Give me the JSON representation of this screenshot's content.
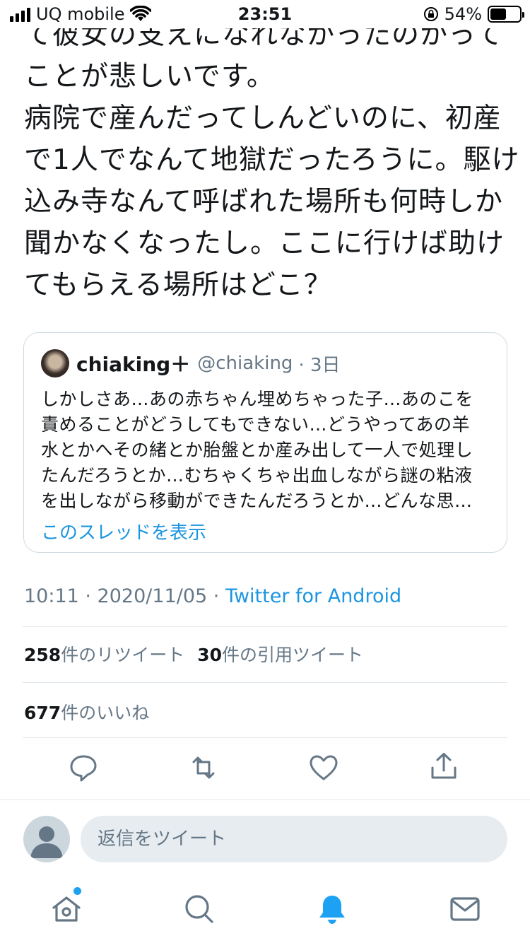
{
  "status_bar": {
    "carrier": "UQ mobile",
    "time": "23:51",
    "battery_percent": "54%",
    "battery_level": 0.54
  },
  "tweet": {
    "lines": [
      "て彼女の支えになれなかったのかって",
      "ことが悲しいです。",
      "病院で産んだってしんどいのに、初産",
      "で1人でなんて地獄だったろうに。駆け",
      "込み寺なんて呼ばれた場所も何時しか",
      "聞かなくなったし。ここに行けば助け",
      "てもらえる場所はどこ？"
    ]
  },
  "quote": {
    "name": "chiaking＋",
    "handle": "@chiaking",
    "time": "· 3日",
    "lines": [
      "しかしさあ…あの赤ちゃん埋めちゃった子…あのこを",
      "責めることがどうしてもできない…どうやってあの羊",
      "水とかへその緒とか胎盤とか産み出して一人で処理し",
      "たんだろうとか…むちゃくちゃ出血しながら謎の粘液",
      "を出しながら移動ができたんだろうとか…どんな思…"
    ],
    "show_thread": "このスレッドを表示"
  },
  "meta": {
    "timestamp": "10:11 · 2020/11/05 · ",
    "source": "Twitter for Android"
  },
  "stats": {
    "retweets_count": "258",
    "retweets_label": "件のリツイート",
    "quotes_count": "30",
    "quotes_label": "件の引用ツイート",
    "likes_count": "677",
    "likes_label": "件のいいね"
  },
  "reply": {
    "placeholder": "返信をツイート"
  },
  "icons": {
    "reply": "reply-icon",
    "retweet": "retweet-icon",
    "like": "like-icon",
    "share": "share-icon",
    "home": "home-icon",
    "search": "search-icon",
    "notifications": "notifications-icon",
    "messages": "messages-icon"
  },
  "colors": {
    "accent": "#1da1f2",
    "link": "#1b95e0",
    "secondary_text": "#657786",
    "icon": "#657786"
  }
}
